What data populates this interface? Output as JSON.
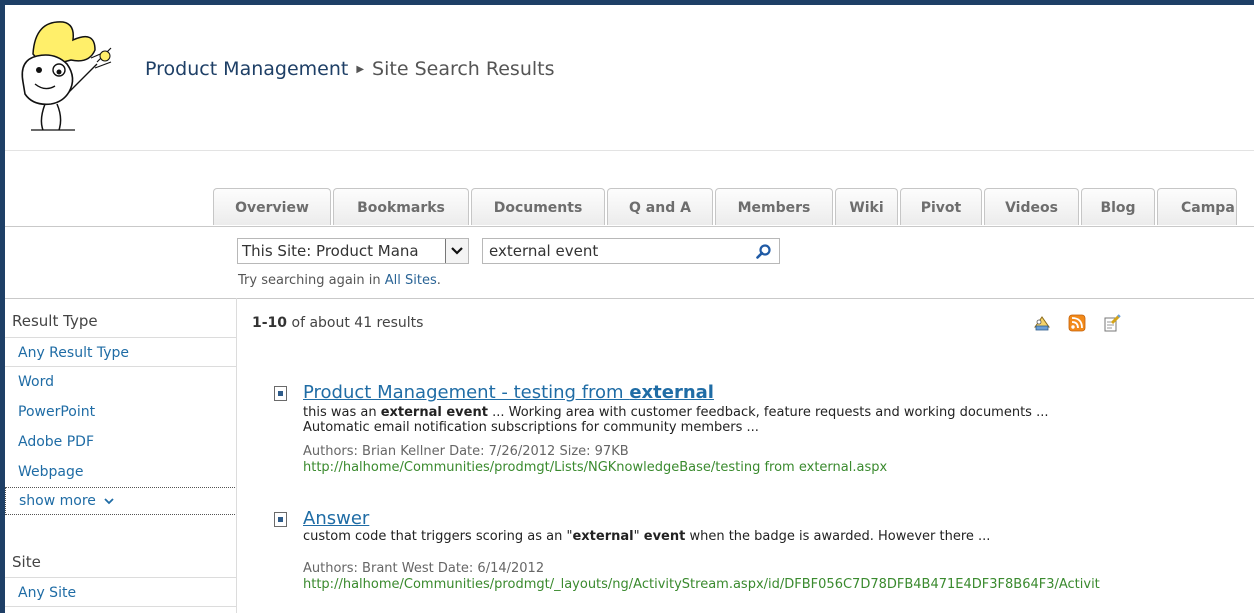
{
  "header": {
    "site_title": "Product Management",
    "page_title": "Site Search Results"
  },
  "tabs": [
    "Overview",
    "Bookmarks",
    "Documents",
    "Q and A",
    "Members",
    "Wiki",
    "Pivot",
    "Videos",
    "Blog",
    "Campa"
  ],
  "search": {
    "scope": "This Site: Product Mana",
    "query": "external event",
    "retry_prefix": "Try searching again in ",
    "retry_link": "All Sites",
    "retry_suffix": "."
  },
  "refiners": {
    "result_type_heading": "Result Type",
    "result_types": [
      "Any Result Type",
      "Word",
      "PowerPoint",
      "Adobe PDF",
      "Webpage"
    ],
    "show_more": "show more",
    "site_heading": "Site",
    "sites": [
      "Any Site"
    ]
  },
  "results_summary": {
    "range": "1-10",
    "rest": " of about 41 results"
  },
  "results": [
    {
      "title_plain": "Product Management - testing from ",
      "title_bold": "external",
      "snippet": [
        {
          "t": "this was an ",
          "b": false
        },
        {
          "t": "external event",
          "b": true
        },
        {
          "t": " ... Working area with customer feedback, feature requests and working documents ... Automatic email notification subscriptions for community members ...",
          "b": false
        }
      ],
      "meta": "Authors: Brian Kellner   Date: 7/26/2012   Size: 97KB",
      "url": "http://halhome/Communities/prodmgt/Lists/NGKnowledgeBase/testing from external.aspx"
    },
    {
      "title_plain": "Answer",
      "title_bold": "",
      "snippet": [
        {
          "t": "custom code that triggers scoring as an \"",
          "b": false
        },
        {
          "t": "external",
          "b": true
        },
        {
          "t": "\" ",
          "b": false
        },
        {
          "t": "event",
          "b": true
        },
        {
          "t": " when the badge is awarded. However there ...",
          "b": false
        }
      ],
      "meta": "Authors: Brant West   Date: 6/14/2012",
      "url": "http://halhome/Communities/prodmgt/_layouts/ng/ActivityStream.aspx/id/DFBF056C7D78DFB4B471E4DF3F8B64F3/Activit"
    }
  ],
  "icons": {
    "logo": "cartoon-logo-icon",
    "breadcrumb_separator": "triangle-right-icon",
    "dropdown": "chevron-down-icon",
    "search": "magnifier-icon",
    "actions": [
      "alert-me-icon",
      "rss-icon",
      "search-action-icon"
    ],
    "result_doc": "document-icon",
    "show_more": "chevron-down-icon"
  },
  "colors": {
    "frame": "#1e3f66",
    "link": "#1f6ca5",
    "url_green": "#3a8a2e",
    "rss_orange": "#f28a1a"
  }
}
